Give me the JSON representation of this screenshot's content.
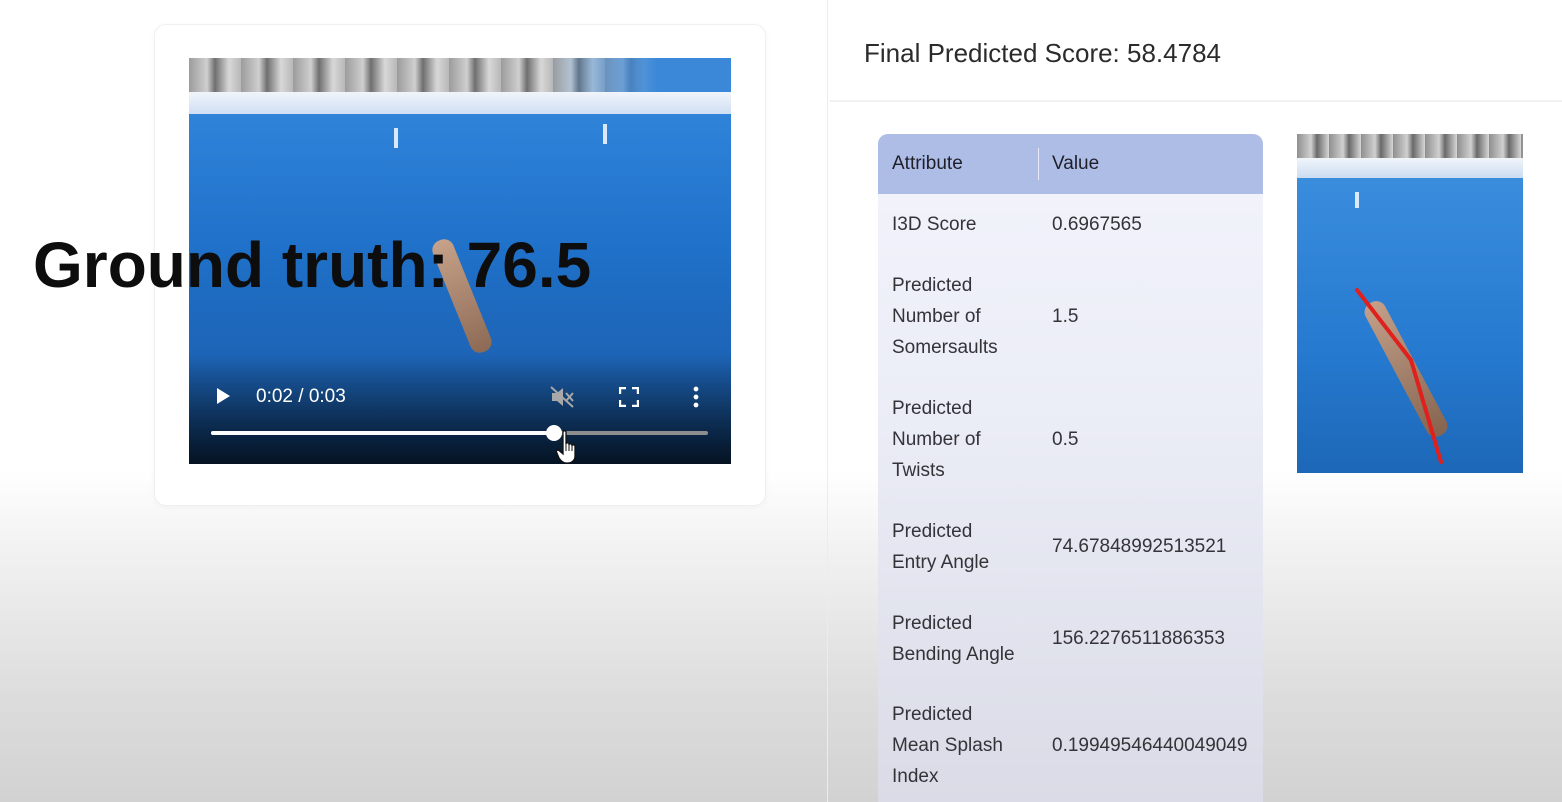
{
  "overlay": {
    "ground_truth": "Ground truth: 76.5"
  },
  "video": {
    "time_display": "0:02 / 0:03",
    "progress_fraction": 0.69,
    "muted": true
  },
  "results": {
    "final_score": "Final Predicted Score: 58.4784",
    "table": {
      "headers": {
        "attribute": "Attribute",
        "value": "Value"
      },
      "rows": [
        {
          "attribute": "I3D Score",
          "value": "0.6967565"
        },
        {
          "attribute": "Predicted Number of Somersaults",
          "value": "1.5"
        },
        {
          "attribute": "Predicted Number of Twists",
          "value": "0.5"
        },
        {
          "attribute": "Predicted Entry Angle",
          "value": "74.67848992513521"
        },
        {
          "attribute": "Predicted Bending Angle",
          "value": "156.2276511886353"
        },
        {
          "attribute": "Predicted Mean Splash Index",
          "value": "0.19949546440049049"
        }
      ]
    }
  },
  "colors": {
    "table_header": "#aebde6",
    "pose_line": "#e0201c",
    "pool_blue": "#1f6fc5"
  }
}
